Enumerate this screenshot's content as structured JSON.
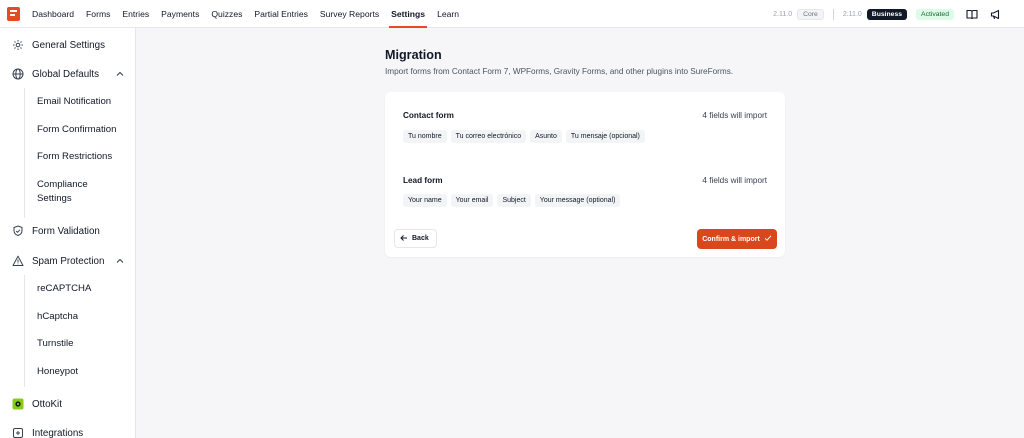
{
  "nav": {
    "items": [
      {
        "label": "Dashboard"
      },
      {
        "label": "Forms"
      },
      {
        "label": "Entries"
      },
      {
        "label": "Payments"
      },
      {
        "label": "Quizzes"
      },
      {
        "label": "Partial Entries"
      },
      {
        "label": "Survey Reports"
      },
      {
        "label": "Settings",
        "active": true
      },
      {
        "label": "Learn"
      }
    ],
    "core_version": "2.11.0",
    "core_label": "Core",
    "business_version": "2.11.0",
    "business_label": "Business",
    "status_label": "Activated",
    "icons": [
      "docs-book-icon",
      "megaphone-icon"
    ]
  },
  "sidebar": {
    "items": [
      {
        "label": "General Settings",
        "icon": "gear-icon"
      },
      {
        "label": "Global Defaults",
        "icon": "globe-icon",
        "expanded": true,
        "children": [
          "Email Notification",
          "Form Confirmation",
          "Form Restrictions",
          "Compliance Settings"
        ]
      },
      {
        "label": "Form Validation",
        "icon": "shield-check-icon"
      },
      {
        "label": "Spam Protection",
        "icon": "warning-triangle-icon",
        "expanded": true,
        "children": [
          "reCAPTCHA",
          "hCaptcha",
          "Turnstile",
          "Honeypot"
        ]
      },
      {
        "label": "OttoKit",
        "icon": "ottokit-icon"
      },
      {
        "label": "Integrations",
        "icon": "integrations-icon"
      }
    ]
  },
  "main": {
    "title": "Migration",
    "subtitle": "Import forms from Contact Form 7, WPForms, Gravity Forms, and other plugins into SureForms.",
    "forms": [
      {
        "name": "Contact form",
        "count": "4 fields will import",
        "fields": [
          "Tu nombre",
          "Tu correo electrónico",
          "Asunto",
          "Tu mensaje (opcional)"
        ]
      },
      {
        "name": "Lead form",
        "count": "4 fields will import",
        "fields": [
          "Your name",
          "Your email",
          "Subject",
          "Your message (optional)"
        ]
      }
    ],
    "back_label": "Back",
    "confirm_label": "Confirm & import"
  },
  "colors": {
    "accent": "#d9481c",
    "brand": "#e24b26",
    "business_badge": "#111827",
    "activated_badge": "#dcfce7"
  }
}
